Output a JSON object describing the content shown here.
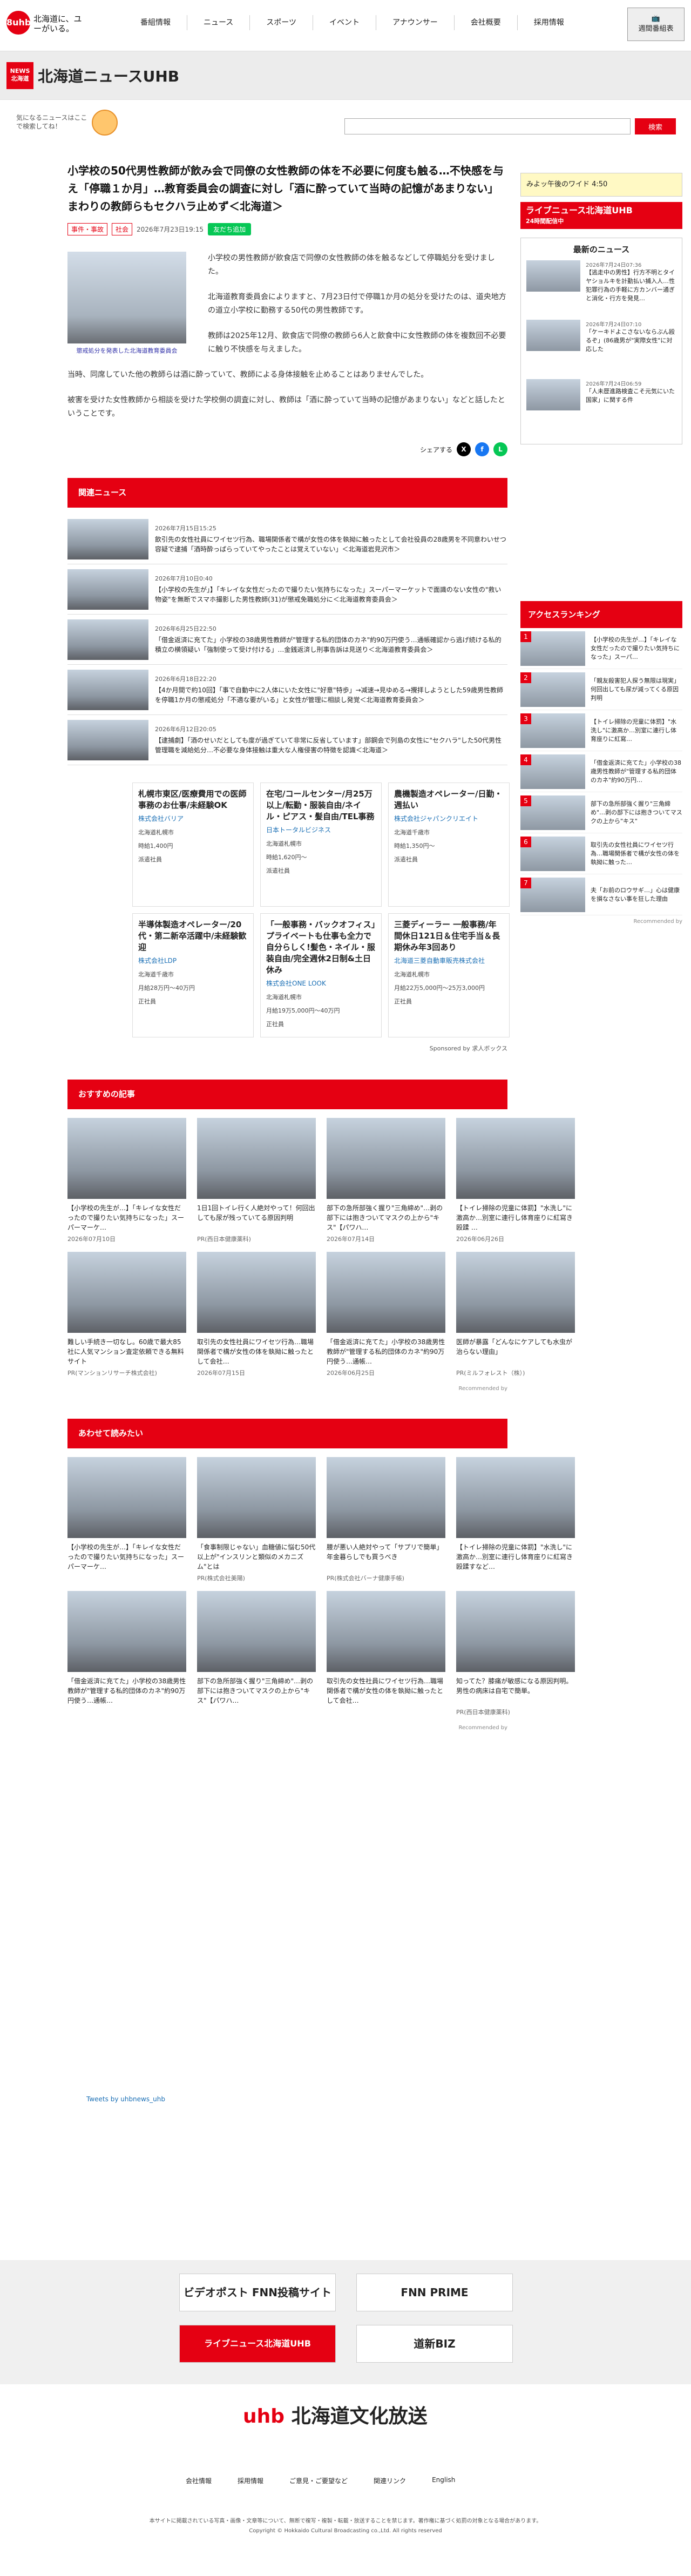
{
  "header": {
    "tagline": "北海道に、ユーがいる。",
    "logo_num": "8uhb",
    "nav": [
      "番組情報",
      "ニュース",
      "スポーツ",
      "イベント",
      "アナウンサー",
      "会社概要",
      "採用情報"
    ],
    "onair_label": "週間番組表"
  },
  "subheader": {
    "badge": "NEWS 北海道",
    "title": "北海道ニュースUHB"
  },
  "search": {
    "note": "気になるニュースはここで検索してね！",
    "placeholder": "",
    "button": "検索"
  },
  "article": {
    "title": "小学校の50代男性教師が飲み会で同僚の女性教師の体を不必要に何度も触る…不快感を与え「停職１か月」…教育委員会の調査に対し「酒に酔っていて当時の記憶があまりない」まわりの教師らもセクハラ止めず＜北海道＞",
    "tags": [
      "事件・事故",
      "社会"
    ],
    "date": "2026年7月23日19:15",
    "line": "友だち追加",
    "caption": "懲戒処分を発表した北海道教育委員会",
    "paras": [
      "小学校の男性教師が飲食店で同僚の女性教師の体を触るなどして停職処分を受けました。",
      "北海道教育委員会によりますと、7月23日付で停職1か月の処分を受けたのは、道央地方の道立小学校に勤務する50代の男性教師です。",
      "教師は2025年12月、飲食店で同僚の教師ら6人と飲食中に女性教師の体を複数回不必要に触り不快感を与えました。",
      "当時、同席していた他の教師らは酒に酔っていて、教師による身体接触を止めることはありませんでした。",
      "被害を受けた女性教師から相談を受けた学校側の調査に対し、教師は「酒に酔っていて当時の記憶があまりない」などと話したということです。"
    ],
    "share": "シェアする"
  },
  "related": {
    "heading": "関連ニュース",
    "items": [
      {
        "date": "2026年7月15日15:25",
        "text": "飲引先の女性社員にワイセツ行為、職場関係者で構が女性の体を執拗に触ったとして会社役員の28歳男を不同意わいせつ容疑で逮捕「酒時酔っぱらっていてやったことは覚えていない」＜北海道岩見沢市＞"
      },
      {
        "date": "2026年7月10日0:40",
        "text": "【小学校の先生が」】「キレイな女性だったので撮りたい気持ちになった」スーパーマーケットで面識のない女性の\"救い物姿\"を無断でスマホ撮影した男性教師(31)が懲戒免職処分に＜北海道教育委員会＞"
      },
      {
        "date": "2026年6月25日22:50",
        "text": "「借金返済に充てた」小学校の38歳男性教師が\"管理する私的団体のカネ\"約90万円使う…通帳確認から逃げ続ける私的積立の横領疑い「強制使って受け付ける」…金銭返済し刑事告訴は見送り＜北海道教育委員会＞"
      },
      {
        "date": "2026年6月18日22:20",
        "text": "【4か月間で約10回】「事で自動中に2人体にいた女性に\"好意\"特歩」→减速→見ゆめる→攪拝しようとした59歳男性教師を停職1か月の懲戒処分「不適な要がいる」と女性が管理に相談し発覚＜北海道教育委員会＞"
      },
      {
        "date": "2026年6月12日20:05",
        "text": "【逮捕劇】「酒のせいだとしても度が過ぎていて非常に反省しています」部鋼会で列島の女性に\"セクハラ\"した50代男性管理職を減給処分…不必要な身体接触は重大な人権侵害の特徴を認識＜北海道＞"
      }
    ]
  },
  "jobs": {
    "items": [
      {
        "title": "札幌市東区/医療費用での医師事務のお仕事/未経験OK",
        "company": "株式会社バリア",
        "loc": "北海道札幌市",
        "pay": "時給1,400円",
        "type": "派遣社員"
      },
      {
        "title": "在宅/コールセンター/月25万以上/転勤・服装自由/ネイル・ピアス・髪自由/TEL事務",
        "company": "日本トータルビジネス",
        "loc": "北海道札幌市",
        "pay": "時給1,620円〜",
        "type": "派遣社員"
      },
      {
        "title": "農機製造オペレーター/日勤・週払い",
        "company": "株式会社ジャパンクリエイト",
        "loc": "北海道千歳市",
        "pay": "時給1,350円〜",
        "type": "派遣社員"
      },
      {
        "title": "半導体製造オペレーター/20代・第二新卒活躍中/未経験歓迎",
        "company": "株式会社LDP",
        "loc": "北海道千歳市",
        "pay": "月給28万円〜40万円",
        "type": "正社員"
      },
      {
        "title": "「一般事務・バックオフィス」プライベートも仕事も全力で自分らしく!髪色・ネイル・服装自由/完全週休2日制&土日休み",
        "company": "株式会社ONE LOOK",
        "loc": "北海道札幌市",
        "pay": "月給19万5,000円〜40万円",
        "type": "正社員"
      },
      {
        "title": "三菱ディーラー 一般事務/年間休日121日＆住宅手当＆長期休み年3回あり",
        "company": "北海道三菱自動車販売株式会社",
        "loc": "北海道札幌市",
        "pay": "月給22万5,000円〜25万3,000円",
        "type": "正社員"
      }
    ],
    "sponsor": "Sponsored by 求人ボックス"
  },
  "recommend": {
    "heading": "おすすめの記事",
    "items": [
      {
        "text": "【小学校の先生が…】「キレイな女性だったので撮りたい気持ちになった」スーパーマーケ…",
        "meta": "2026年07月10日"
      },
      {
        "text": "1日1回トイレ行く人絶対やって！何回出しても尿が残っていてる原因判明",
        "meta": "PR(西日本健康薬科)"
      },
      {
        "text": "部下の急所部強く握り\"三角締め\"…剥の部下には抱きついてマスクの上から\"キス\"【パワハ…",
        "meta": "2026年07月14日"
      },
      {
        "text": "【トイレ掃除の児童に体罰】\"水洗し\"に激高か…別室に連行し体育座りに紅寫き殴蹂 …",
        "meta": "2026年06月26日"
      },
      {
        "text": "難しい手続き一切なし。60歳で最大85社に人気マンション査定依頼できる無料サイト",
        "meta": "PR(マンションリサーチ株式会社)"
      },
      {
        "text": "取引先の女性社員にワイセツ行為…職場関係者で構が女性の体を執拗に触ったとして会社…",
        "meta": "2026年07月15日"
      },
      {
        "text": "「借金返済に充てた」小学校の38歳男性教師が\"管理する私的団体のカネ\"約90万円使う…通帳…",
        "meta": "2026年06月25日"
      },
      {
        "text": "医師が暴露「どんなにケアしても水虫が治らない理由」",
        "meta": "PR(ミルフォレスト（株）)"
      }
    ],
    "by": "Recommended by"
  },
  "alsoread": {
    "heading": "あわせて読みたい",
    "items": [
      {
        "text": "【小学校の先生が…】「キレイな女性だったので撮りたい気持ちになった」スーパーマーケ…",
        "meta": ""
      },
      {
        "text": "「食事制限じゃない」血糖値に悩む50代以上が\"インスリンと類似のメカニズム\"とは",
        "meta": "PR(株式会社美陽)"
      },
      {
        "text": "腰が悪い人絶対やって「サプリで簡単」年金暮らしでも買うべき",
        "meta": "PR(株式会社バーナ健康手帳)"
      },
      {
        "text": "【トイレ掃除の児童に体罰】\"水洗し\"に激高か…別室に連行し体育座りに紅寫き殴蹂すなど…",
        "meta": ""
      },
      {
        "text": "「借金返済に充てた」小学校の38歳男性教師が\"管理する私的団体のカネ\"約90万円使う…通帳…",
        "meta": ""
      },
      {
        "text": "部下の急所部強く握り\"三角締め\"…剥の部下には抱きついてマスクの上から\"キス\"【パワハ…",
        "meta": ""
      },
      {
        "text": "取引先の女性社員にワイセツ行為…職場関係者で構が女性の体を執拗に触ったとして会社…",
        "meta": ""
      },
      {
        "text": "知ってた？膝痛が敏感になる原因判明。男性の病床は自宅で簡単。",
        "meta": "PR(西日本健康薬科)"
      }
    ],
    "by": "Recommended by"
  },
  "sidebar": {
    "onair": "みよッ午後のワイド 4:50",
    "live": "ライブニュース北海道UHB",
    "live_sub": "24時間配信中",
    "latest_title": "最新のニュース",
    "latest": [
      {
        "date": "2026年7月24日07:36",
        "text": "【逃走中の男性】行方不明とタイヤショルキを計勤払い捕入人…性犯罪行為の手軽に方カンバー通ぎと消化・行方を発見…"
      },
      {
        "date": "2026年7月24日07:10",
        "text": "「ケーキドよこさないならぶん殴るぞ」(86歳男が\"実際女性\"に対応した"
      },
      {
        "date": "2026年7月24日06:59",
        "text": "「人未歴進路検査こそ元気にいた国家」に関する件"
      }
    ],
    "rank_title": "アクセスランキング",
    "ranks": [
      "【小学校の先生が…】「キレイな女性だったので撮りたい気持ちになった」スーパ…",
      "「親友殺害犯人探う無限は現実」何回出しても尿が減ってくる原因判明",
      "【トイレ掃除の児童に体罰】\"水洗し\"に激高か…別室に連行し体育座りに紅寫…",
      "「借金返済に充てた」小学校の38歳男性教師が\"管理する私的団体のカネ\"約90万円…",
      "部下の急所部強く握り\"三角締め\"…剥の部下には抱きついてマスクの上から\"キス\"",
      "取引先の女性社員にワイセツ行為…職場関係者で構が女性の体を執拗に触った…",
      "夫「お前のロウサギ…」心は健康を損なさない事を狂した理由"
    ],
    "rank_by": "Recommended by"
  },
  "tweet": "Tweets by uhbnews_uhb",
  "banners": [
    "ビデオポスト FNN投稿サイト",
    "FNN PRIME",
    "ライブニュース北海道UHB",
    "道新BIZ"
  ],
  "footer": {
    "logo_sub": "uhb",
    "logo_main": "北海道文化放送",
    "links": [
      "会社情報",
      "採用情報",
      "ご意見・ご要望など",
      "関連リンク",
      "English"
    ],
    "disclaimer": "本サイトに掲載されている写真・画像・文章等について、無断で複写・複製・転載・放送することを禁じます。著作権に基づく処罰の対象となる場合があります。",
    "copyright": "Copyright © Hokkaido Cultural Broadcasting co.,Ltd. All rights reserved"
  }
}
